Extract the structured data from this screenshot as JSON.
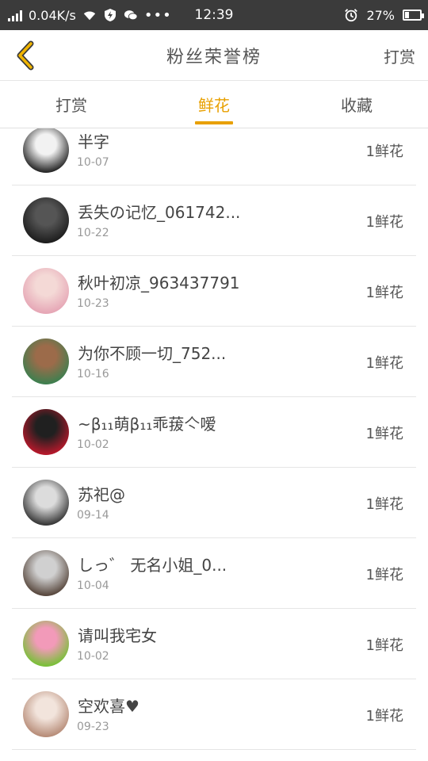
{
  "status_bar": {
    "speed": "0.04K/s",
    "time": "12:39",
    "battery": "27%",
    "battery_level": 0.27
  },
  "header": {
    "back_icon": "chevron-left-icon",
    "title": "粉丝荣誉榜",
    "action_label": "打赏"
  },
  "tabs": [
    {
      "label": "打赏",
      "active": false
    },
    {
      "label": "鲜花",
      "active": true
    },
    {
      "label": "收藏",
      "active": false
    }
  ],
  "colors": {
    "accent": "#e8a000",
    "status_bar": "#3b3b3b"
  },
  "fans": [
    {
      "name": "半字",
      "date": "10-07",
      "amount": "1鲜花",
      "avatar_colors": [
        "#f2f2f2",
        "#2a2a2a"
      ]
    },
    {
      "name": "丢失の记忆_061742...",
      "date": "10-22",
      "amount": "1鲜花",
      "avatar_colors": [
        "#555555",
        "#1e1e1e"
      ]
    },
    {
      "name": "秋叶初凉_963437791",
      "date": "10-23",
      "amount": "1鲜花",
      "avatar_colors": [
        "#f4d9d6",
        "#e6a7b6"
      ]
    },
    {
      "name": "为你不顾一切_752...",
      "date": "10-16",
      "amount": "1鲜花",
      "avatar_colors": [
        "#9c6b4a",
        "#3f7f4f"
      ]
    },
    {
      "name": "~β₁₁萌β₁₁乖菝亽嗳",
      "date": "10-02",
      "amount": "1鲜花",
      "avatar_colors": [
        "#202020",
        "#b4192b"
      ]
    },
    {
      "name": "苏祀@",
      "date": "09-14",
      "amount": "1鲜花",
      "avatar_colors": [
        "#dcdcdc",
        "#3a3a3a"
      ]
    },
    {
      "name": "しっ゛ 无名小姐_0...",
      "date": "10-04",
      "amount": "1鲜花",
      "avatar_colors": [
        "#d0d0d0",
        "#5a4a40"
      ]
    },
    {
      "name": "请叫我宅女",
      "date": "10-02",
      "amount": "1鲜花",
      "avatar_colors": [
        "#f29ab9",
        "#7bbf3a"
      ]
    },
    {
      "name": "空欢喜♥",
      "date": "09-23",
      "amount": "1鲜花",
      "avatar_colors": [
        "#f2e4dc",
        "#b88e7a"
      ]
    }
  ]
}
